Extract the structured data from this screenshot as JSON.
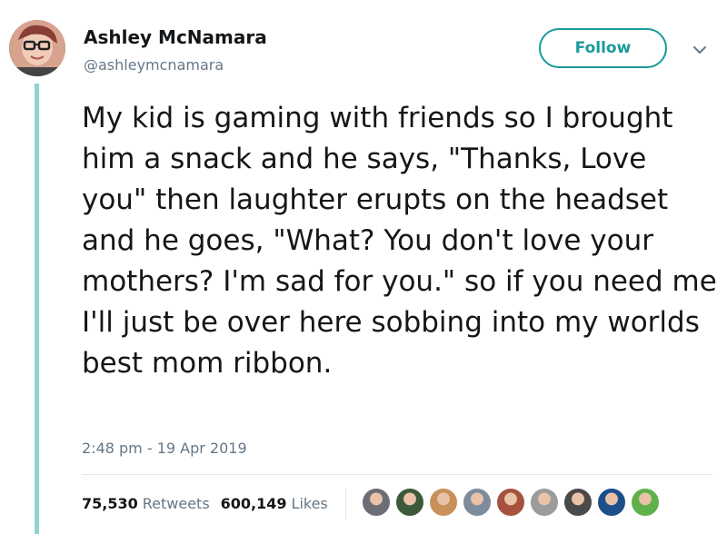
{
  "author": {
    "name": "Ashley McNamara",
    "handle": "@ashleymcnamara"
  },
  "header": {
    "follow_label": "Follow"
  },
  "tweet": {
    "text": "My kid is gaming with friends so I brought him a snack and he says, \"Thanks, Love you\" then laughter erupts on the headset and he goes, \"What? You don't love your mothers? I'm sad for you.\" so if you need me I'll just be over here sobbing into my worlds best mom ribbon.",
    "timestamp": "2:48 pm - 19 Apr 2019"
  },
  "stats": {
    "retweets_count": "75,530",
    "retweets_label": "Retweets",
    "likes_count": "600,149",
    "likes_label": "Likes"
  },
  "colors": {
    "accent": "#1a9a9a",
    "thread_line": "#8fd3d3",
    "muted_text": "#657786",
    "primary_text": "#14171a"
  },
  "likers": [
    {
      "icon": "avatar-icon",
      "color": "#6b6f75"
    },
    {
      "icon": "avatar-icon",
      "color": "#3c5a3a"
    },
    {
      "icon": "avatar-icon",
      "color": "#c8915a"
    },
    {
      "icon": "avatar-icon",
      "color": "#7d8c9a"
    },
    {
      "icon": "avatar-icon",
      "color": "#a5523e"
    },
    {
      "icon": "avatar-icon",
      "color": "#9b9b9b"
    },
    {
      "icon": "avatar-icon",
      "color": "#4a4a4a"
    },
    {
      "icon": "avatar-icon",
      "color": "#1c4f8a"
    },
    {
      "icon": "avatar-icon",
      "color": "#5fb14b"
    }
  ]
}
